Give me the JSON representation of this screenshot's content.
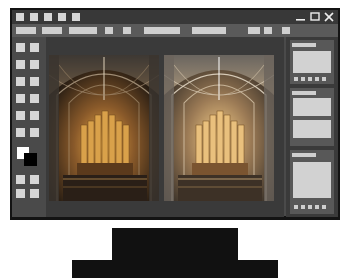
{
  "window": {
    "controls": {
      "minimize_glyph": "—",
      "maximize_glyph": "☐",
      "close_glyph": "✕"
    },
    "titlebar_icons": [
      "app-icon-1",
      "app-icon-2",
      "app-icon-3",
      "app-icon-4",
      "app-icon-5"
    ]
  },
  "menubar": {
    "items": [
      "",
      "",
      "",
      "",
      "",
      "",
      "",
      ""
    ]
  },
  "toolbox": {
    "tools": [
      "tool-1",
      "tool-2",
      "tool-3",
      "tool-4",
      "tool-5",
      "tool-6",
      "tool-7",
      "tool-8",
      "tool-9",
      "tool-10",
      "tool-11",
      "tool-12",
      "tool-13",
      "tool-14"
    ],
    "color_foreground": "#000000",
    "color_background": "#ffffff"
  },
  "canvas": {
    "images": [
      {
        "name": "cathedral-organ-photo-left",
        "style": "warm"
      },
      {
        "name": "cathedral-organ-photo-right",
        "style": "bright"
      }
    ]
  },
  "panels": [
    {
      "name": "panel-1"
    },
    {
      "name": "panel-2"
    },
    {
      "name": "panel-3"
    }
  ],
  "colors": {
    "frame": "#131313",
    "window": "#4a4a4a",
    "titlebar": "#383838",
    "menubar": "#5a5a5a",
    "workspace": "#3a3a3a",
    "ui_light": "#d6d6d6"
  }
}
